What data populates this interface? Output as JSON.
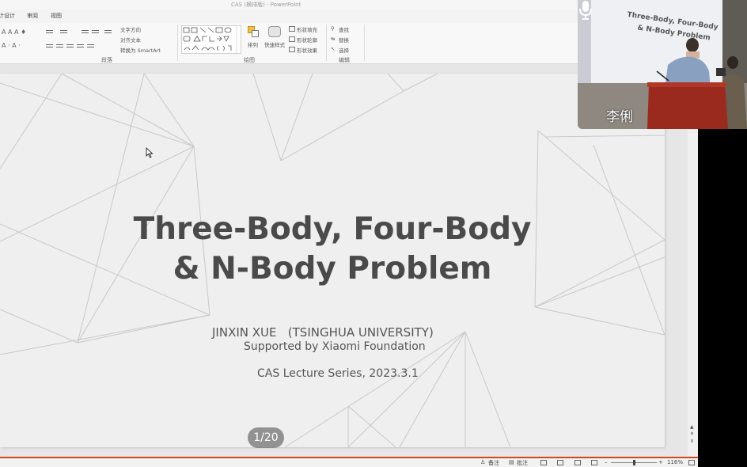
{
  "window": {
    "title": "CAS (横排版) - PowerPoint"
  },
  "tabs": [
    "计设计",
    "审阅",
    "视图"
  ],
  "ribbon": {
    "groups": {
      "paragraph": "段落",
      "drawing": "绘图",
      "editing": "编辑"
    },
    "paragraph_items": {
      "text_direction": "文字方向",
      "align_text": "对齐文本",
      "smartart": "转换为 SmartArt"
    },
    "drawing_items": {
      "arrange": "排列",
      "quick_styles": "快速样式",
      "shape_fill": "形状填充",
      "shape_outline": "形状轮廓",
      "shape_effects": "形状效果"
    },
    "editing_items": {
      "find": "查找",
      "replace": "替换",
      "select": "选择"
    }
  },
  "slide": {
    "title_line1": "Three-Body, Four-Body",
    "title_line2": "& N-Body Problem",
    "author": "JINXIN XUE   (TSINGHUA UNIVERSITY)",
    "support": "Supported by Xiaomi Foundation",
    "series": "CAS Lecture Series, 2023.3.1"
  },
  "page_indicator": "1/20",
  "statusbar": {
    "notes": "备注",
    "comments": "批注",
    "zoom": "116%"
  },
  "webcam": {
    "speaker_name": "李俐",
    "projected_title_line1": "Three-Body, Four-Body",
    "projected_title_line2": "& N-Body Problem"
  },
  "colors": {
    "accent": "#d24726",
    "slide_title": "#4a4a4a",
    "slide_bg": "#efefef"
  },
  "icons": [
    "cursor-icon",
    "mic-icon",
    "find-icon",
    "replace-icon",
    "select-icon",
    "notes-icon",
    "comments-icon",
    "normal-view-icon",
    "slide-sorter-icon",
    "reading-view-icon",
    "slideshow-icon",
    "fit-window-icon"
  ]
}
